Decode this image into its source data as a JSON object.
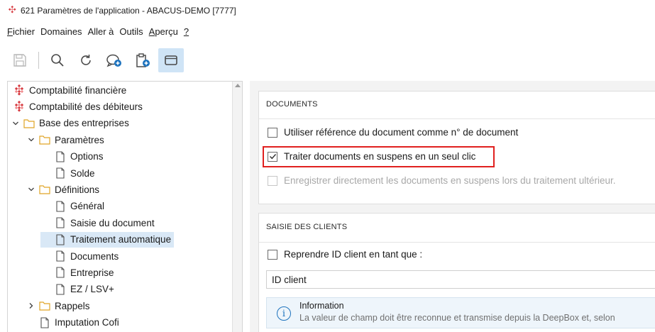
{
  "window": {
    "title": "621 Paramètres de l'application - ABACUS-DEMO [7777]",
    "icon": "abacus-diamond-icon"
  },
  "menubar": {
    "items": [
      {
        "pre": "",
        "ul": "F",
        "post": "ichier"
      },
      {
        "pre": "",
        "ul": "",
        "post": "Domaines"
      },
      {
        "pre": "",
        "ul": "",
        "post": "Aller à"
      },
      {
        "pre": "",
        "ul": "",
        "post": "Outils"
      },
      {
        "pre": "",
        "ul": "A",
        "post": "perçu"
      },
      {
        "pre": "",
        "ul": "?",
        "post": ""
      }
    ]
  },
  "toolbar": {
    "buttons": [
      "save-icon",
      "search-icon",
      "refresh-icon",
      "add-comment-icon",
      "add-clipboard-icon",
      "window-icon"
    ]
  },
  "tree": {
    "items": [
      {
        "label": "Comptabilité financière",
        "icon": "abacus-diamond-icon"
      },
      {
        "label": "Comptabilité des débiteurs",
        "icon": "abacus-diamond-icon"
      },
      {
        "label": "Base des entreprises",
        "icon": "folder-icon",
        "expanded": true
      },
      {
        "label": "Paramètres",
        "icon": "folder-icon",
        "expanded": true
      },
      {
        "label": "Options",
        "icon": "document-icon"
      },
      {
        "label": "Solde",
        "icon": "document-icon"
      },
      {
        "label": "Définitions",
        "icon": "folder-icon",
        "expanded": true
      },
      {
        "label": "Général",
        "icon": "document-icon"
      },
      {
        "label": "Saisie du document",
        "icon": "document-icon"
      },
      {
        "label": "Traitement automatique",
        "icon": "document-icon",
        "selected": true
      },
      {
        "label": "Documents",
        "icon": "document-icon"
      },
      {
        "label": "Entreprise",
        "icon": "document-icon"
      },
      {
        "label": "EZ / LSV+",
        "icon": "document-icon"
      },
      {
        "label": "Rappels",
        "icon": "folder-icon",
        "expanded": false
      },
      {
        "label": "Imputation Cofi",
        "icon": "document-icon"
      }
    ]
  },
  "documents_panel": {
    "title": "DOCUMENTS",
    "options": [
      {
        "label": "Utiliser référence du document comme n° de document",
        "checked": false,
        "disabled": false
      },
      {
        "label": "Traiter documents en suspens en un seul clic",
        "checked": true,
        "disabled": false,
        "highlighted": true
      },
      {
        "label": "Enregistrer directement les documents en suspens lors du traitement ultérieur.",
        "checked": false,
        "disabled": true
      }
    ]
  },
  "clients_panel": {
    "title": "SAISIE DES CLIENTS",
    "option": {
      "label": "Reprendre ID client en tant que :",
      "checked": false
    },
    "field_value": "ID client",
    "info": {
      "title": "Information",
      "text": "La valeur de champ doit être reconnue et transmise depuis la DeepBox et, selon"
    }
  },
  "colors": {
    "selection": "#d9e8f6",
    "highlight": "#e0201f",
    "active_tool": "#cfe4f6",
    "accent": "#1e73be"
  }
}
